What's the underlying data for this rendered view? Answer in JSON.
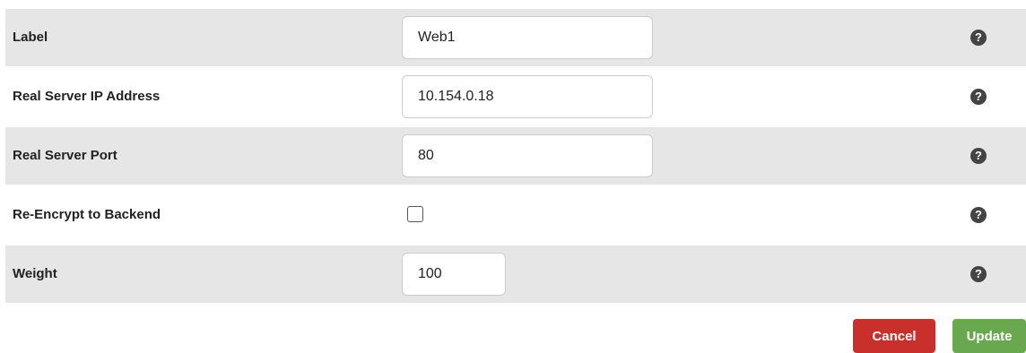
{
  "form": {
    "rows": [
      {
        "label": "Label",
        "value": "Web1"
      },
      {
        "label": "Real Server IP Address",
        "value": "10.154.0.18"
      },
      {
        "label": "Real Server Port",
        "value": "80"
      },
      {
        "label": "Re-Encrypt to Backend",
        "checked": false
      },
      {
        "label": "Weight",
        "value": "100"
      }
    ],
    "help_glyph": "?"
  },
  "buttons": {
    "cancel_label": "Cancel",
    "update_label": "Update"
  },
  "colors": {
    "row_shade": "#e6e6e6",
    "cancel": "#c9302c",
    "update": "#6aa84f",
    "help_icon": "#444444"
  },
  "icons": {
    "help": "question-circle-icon"
  }
}
